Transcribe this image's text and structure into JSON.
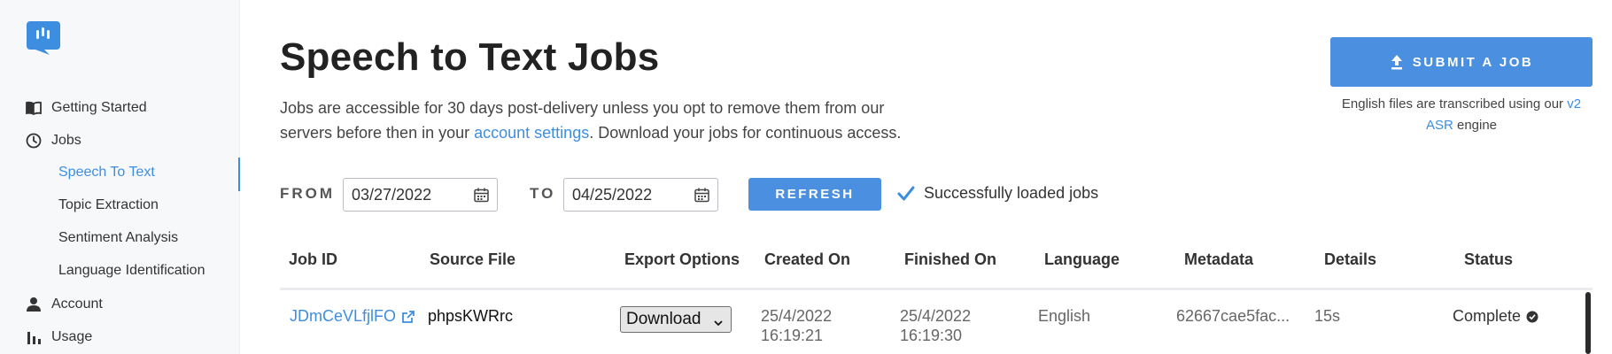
{
  "app": {
    "logo_icon": "speech-bubble-waveform-icon"
  },
  "sidebar": {
    "items": [
      {
        "label": "Getting Started",
        "icon": "book-icon"
      },
      {
        "label": "Jobs",
        "icon": "clock-icon"
      },
      {
        "label": "Account",
        "icon": "person-icon"
      },
      {
        "label": "Usage",
        "icon": "bar-chart-icon"
      }
    ],
    "jobs_subitems": [
      {
        "label": "Speech To Text",
        "active": true
      },
      {
        "label": "Topic Extraction",
        "active": false
      },
      {
        "label": "Sentiment Analysis",
        "active": false
      },
      {
        "label": "Language Identification",
        "active": false
      }
    ]
  },
  "page": {
    "title": "Speech to Text Jobs",
    "desc_part1": "Jobs are accessible for 30 days post-delivery unless you opt to remove them from our servers before then in your ",
    "desc_link": "account settings",
    "desc_part2": ". Download your jobs for continuous access."
  },
  "submit": {
    "label": "SUBMIT A JOB",
    "note_part1": "English files are transcribed using our ",
    "note_link": "v2 ASR",
    "note_part2": " engine"
  },
  "filters": {
    "from_label": "FROM",
    "from_value": "03/27/2022",
    "to_label": "TO",
    "to_value": "04/25/2022",
    "refresh_label": "REFRESH",
    "status_text": "Successfully loaded jobs"
  },
  "table": {
    "columns": [
      "Job ID",
      "Source File",
      "Export Options",
      "Created On",
      "Finished On",
      "Language",
      "Metadata",
      "Details",
      "Status"
    ],
    "rows": [
      {
        "job_id": "JDmCeVLfjlFO",
        "source_file": "phpsKWRrc",
        "export_option": "Download",
        "created_date": "25/4/2022",
        "created_time": "16:19:21",
        "finished_date": "25/4/2022",
        "finished_time": "16:19:30",
        "language": "English",
        "metadata": "62667cae5fac...",
        "details": "15s",
        "status": "Complete"
      }
    ]
  },
  "colors": {
    "accent": "#4a8fe0",
    "link": "#3d8ee0"
  }
}
